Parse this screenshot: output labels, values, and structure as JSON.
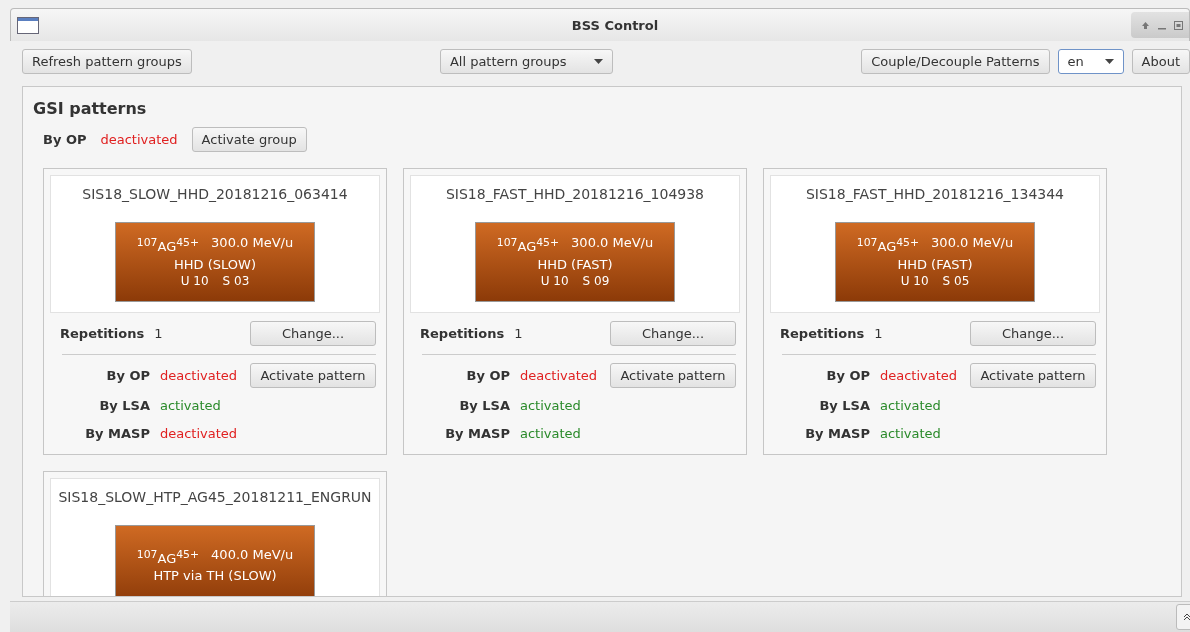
{
  "window": {
    "title": "BSS Control"
  },
  "toolbar": {
    "refresh_button": "Refresh pattern groups",
    "group_select": {
      "value": "All pattern groups"
    },
    "couple_button": "Couple/Decouple Patterns",
    "language_select": {
      "value": "en"
    },
    "about_button": "About"
  },
  "group": {
    "title": "GSI patterns",
    "status_label": "By OP",
    "status_value": "deactivated",
    "status_active": false,
    "activate_button": "Activate group"
  },
  "patterns": [
    {
      "name": "SIS18_SLOW_HHD_20181216_063414",
      "isotope": "$^{107}$AG$^{45+}$",
      "energy": "300.0 MeV/u",
      "mode": "HHD (SLOW)",
      "unit": "U 10",
      "sequence": "S 03",
      "repetitions_label": "Repetitions",
      "repetitions": "1",
      "change_button": "Change...",
      "activate_button": "Activate pattern",
      "statuses": [
        {
          "label": "By OP",
          "value": "deactivated",
          "active": false
        },
        {
          "label": "By LSA",
          "value": "activated",
          "active": true
        },
        {
          "label": "By MASP",
          "value": "deactivated",
          "active": false
        }
      ]
    },
    {
      "name": "SIS18_FAST_HHD_20181216_104938",
      "isotope": "$^{107}$AG$^{45+}$",
      "energy": "300.0 MeV/u",
      "mode": "HHD (FAST)",
      "unit": "U 10",
      "sequence": "S 09",
      "repetitions_label": "Repetitions",
      "repetitions": "1",
      "change_button": "Change...",
      "activate_button": "Activate pattern",
      "statuses": [
        {
          "label": "By OP",
          "value": "deactivated",
          "active": false
        },
        {
          "label": "By LSA",
          "value": "activated",
          "active": true
        },
        {
          "label": "By MASP",
          "value": "activated",
          "active": true
        }
      ]
    },
    {
      "name": "SIS18_FAST_HHD_20181216_134344",
      "isotope": "$^{107}$AG$^{45+}$",
      "energy": "300.0 MeV/u",
      "mode": "HHD (FAST)",
      "unit": "U 10",
      "sequence": "S 05",
      "repetitions_label": "Repetitions",
      "repetitions": "1",
      "change_button": "Change...",
      "activate_button": "Activate pattern",
      "statuses": [
        {
          "label": "By OP",
          "value": "deactivated",
          "active": false
        },
        {
          "label": "By LSA",
          "value": "activated",
          "active": true
        },
        {
          "label": "By MASP",
          "value": "activated",
          "active": true
        }
      ]
    },
    {
      "name": "SIS18_SLOW_HTP_AG45_20181211_ENGRUN",
      "isotope": "$^{107}$AG$^{45+}$",
      "energy": "400.0 MeV/u",
      "mode": "HTP via TH (SLOW)"
    }
  ]
}
